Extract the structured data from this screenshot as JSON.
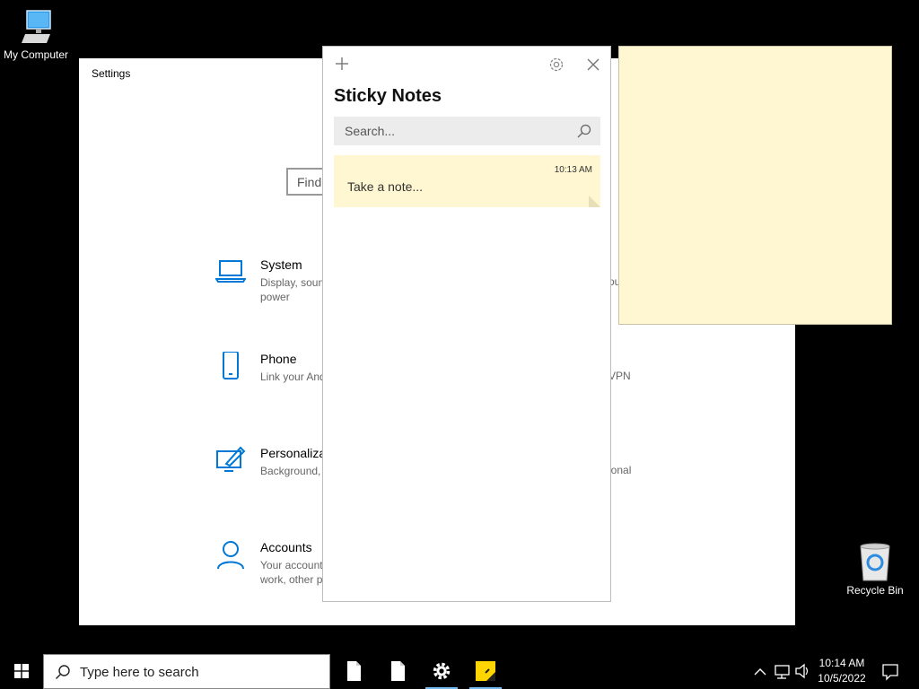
{
  "desktop": {
    "icons": [
      {
        "label": "My Computer",
        "icon": "monitor-icon"
      },
      {
        "label": "Recycle Bin",
        "icon": "recycle-bin-icon"
      }
    ]
  },
  "settings": {
    "title": "Settings",
    "find_placeholder": "Find",
    "categories": [
      {
        "name": "System",
        "desc": "Display, soun power",
        "icon": "laptop-icon"
      },
      {
        "name": "Phone",
        "desc": "Link your And",
        "icon": "phone-icon"
      },
      {
        "name": "Personaliza",
        "desc": "Background,",
        "icon": "personalization-icon"
      },
      {
        "name": "Accounts",
        "desc": "Your account work, other p",
        "icon": "person-icon"
      }
    ],
    "fragments": [
      "ou",
      "VPN",
      "ional"
    ]
  },
  "sticky": {
    "title": "Sticky Notes",
    "search_placeholder": "Search...",
    "notes": [
      {
        "time": "10:13 AM",
        "text": "Take a note...",
        "color": "#fff7d1"
      }
    ]
  },
  "taskbar": {
    "search_placeholder": "Type here to search",
    "apps": [
      {
        "name": "file-icon"
      },
      {
        "name": "file-icon"
      },
      {
        "name": "gear-icon",
        "active": true
      },
      {
        "name": "sticky-notes-icon",
        "active": true
      }
    ],
    "time": "10:14 AM",
    "date": "10/5/2022"
  },
  "colors": {
    "accent": "#0078d7",
    "note": "#fff7d1",
    "taskbar": "#000000"
  }
}
